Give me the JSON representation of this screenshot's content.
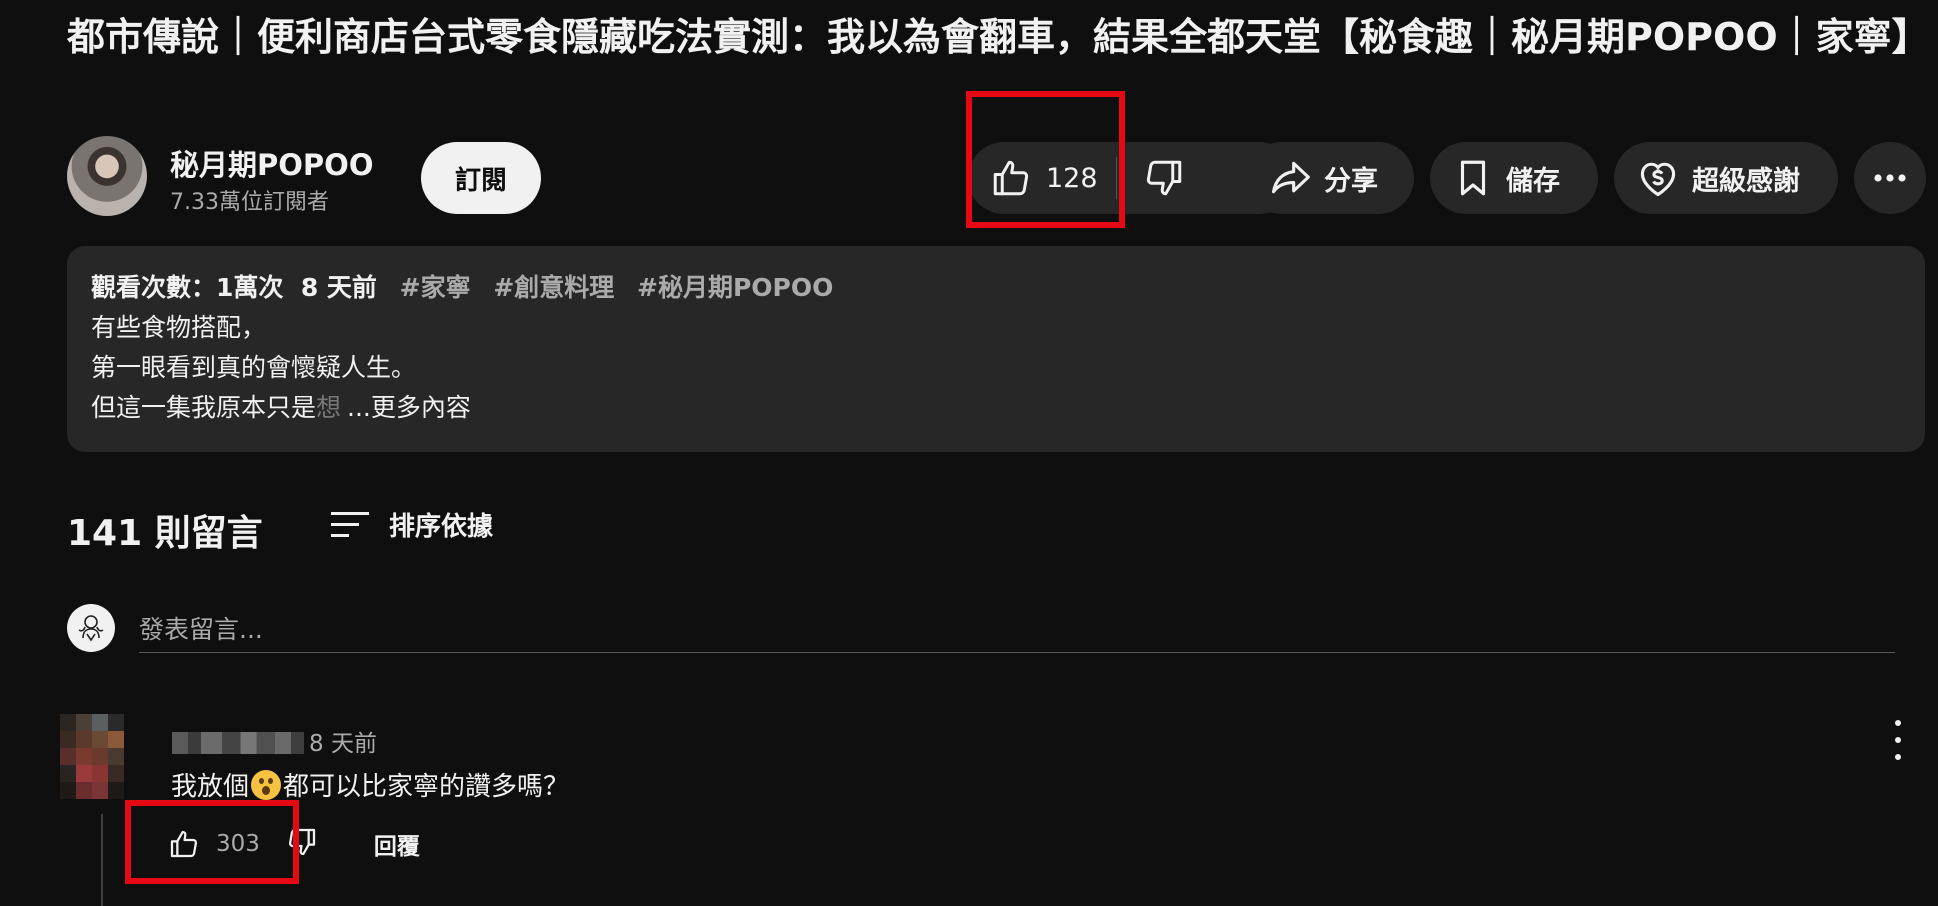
{
  "video": {
    "title": "都市傳說｜便利商店台式零食隱藏吃法實測：我以為會翻車，結果全都天堂【秘食趣｜秘月期POPOO｜家寧】"
  },
  "channel": {
    "name": "秘月期POPOO",
    "subscribers": "7.33萬位訂閱者",
    "subscribe_label": "訂閱"
  },
  "actions": {
    "like_count": "128",
    "share_label": "分享",
    "save_label": "儲存",
    "thanks_label": "超級感謝"
  },
  "description": {
    "views": "觀看次數：1萬次",
    "date": "8 天前",
    "hashtags": [
      "#家寧",
      "#創意料理",
      "#秘月期POPOO"
    ],
    "line1": "有些食物搭配，",
    "line2": "第一眼看到真的會懷疑人生。",
    "line3": "但這一集我原本只是",
    "line3_faded": "想",
    "more_label": "...更多內容"
  },
  "comments": {
    "count_label": "141 則留言",
    "sort_label": "排序依據",
    "add_placeholder": "發表留言...",
    "items": [
      {
        "time": "8 天前",
        "text_before": "我放個",
        "text_after": "都可以比家寧的讚多嗎？",
        "like_count": "303",
        "reply_label": "回覆"
      }
    ]
  },
  "colors": {
    "background": "#0f0f0f",
    "pill": "#272727",
    "highlight": "#e50914"
  }
}
